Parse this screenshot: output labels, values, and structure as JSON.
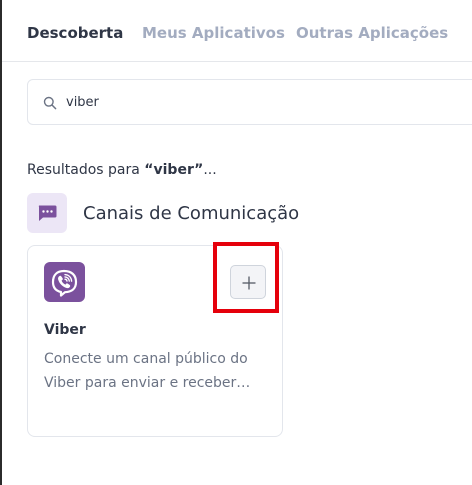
{
  "tabs": [
    {
      "label": "Descoberta",
      "active": true
    },
    {
      "label": "Meus Aplicativos",
      "active": false
    },
    {
      "label": "Outras Aplicações",
      "active": false
    }
  ],
  "search": {
    "value": "viber",
    "icon": "search-icon"
  },
  "results": {
    "prefix": "Resultados para ",
    "query": "“viber”",
    "suffix": "..."
  },
  "category": {
    "title": "Canais de Comunicação",
    "icon": "chat-bubble-icon",
    "icon_color": "#7b519d"
  },
  "card": {
    "title": "Viber",
    "description_line1": "Conecte um canal público do",
    "description_line2": "Viber para enviar e receber…",
    "logo": "viber-phone-icon",
    "brand_color": "#7b519d",
    "add_icon": "plus-icon"
  },
  "colors": {
    "highlight": "#e5000b",
    "tab_active": "#2f3646",
    "tab_inactive": "#a3acc0"
  }
}
